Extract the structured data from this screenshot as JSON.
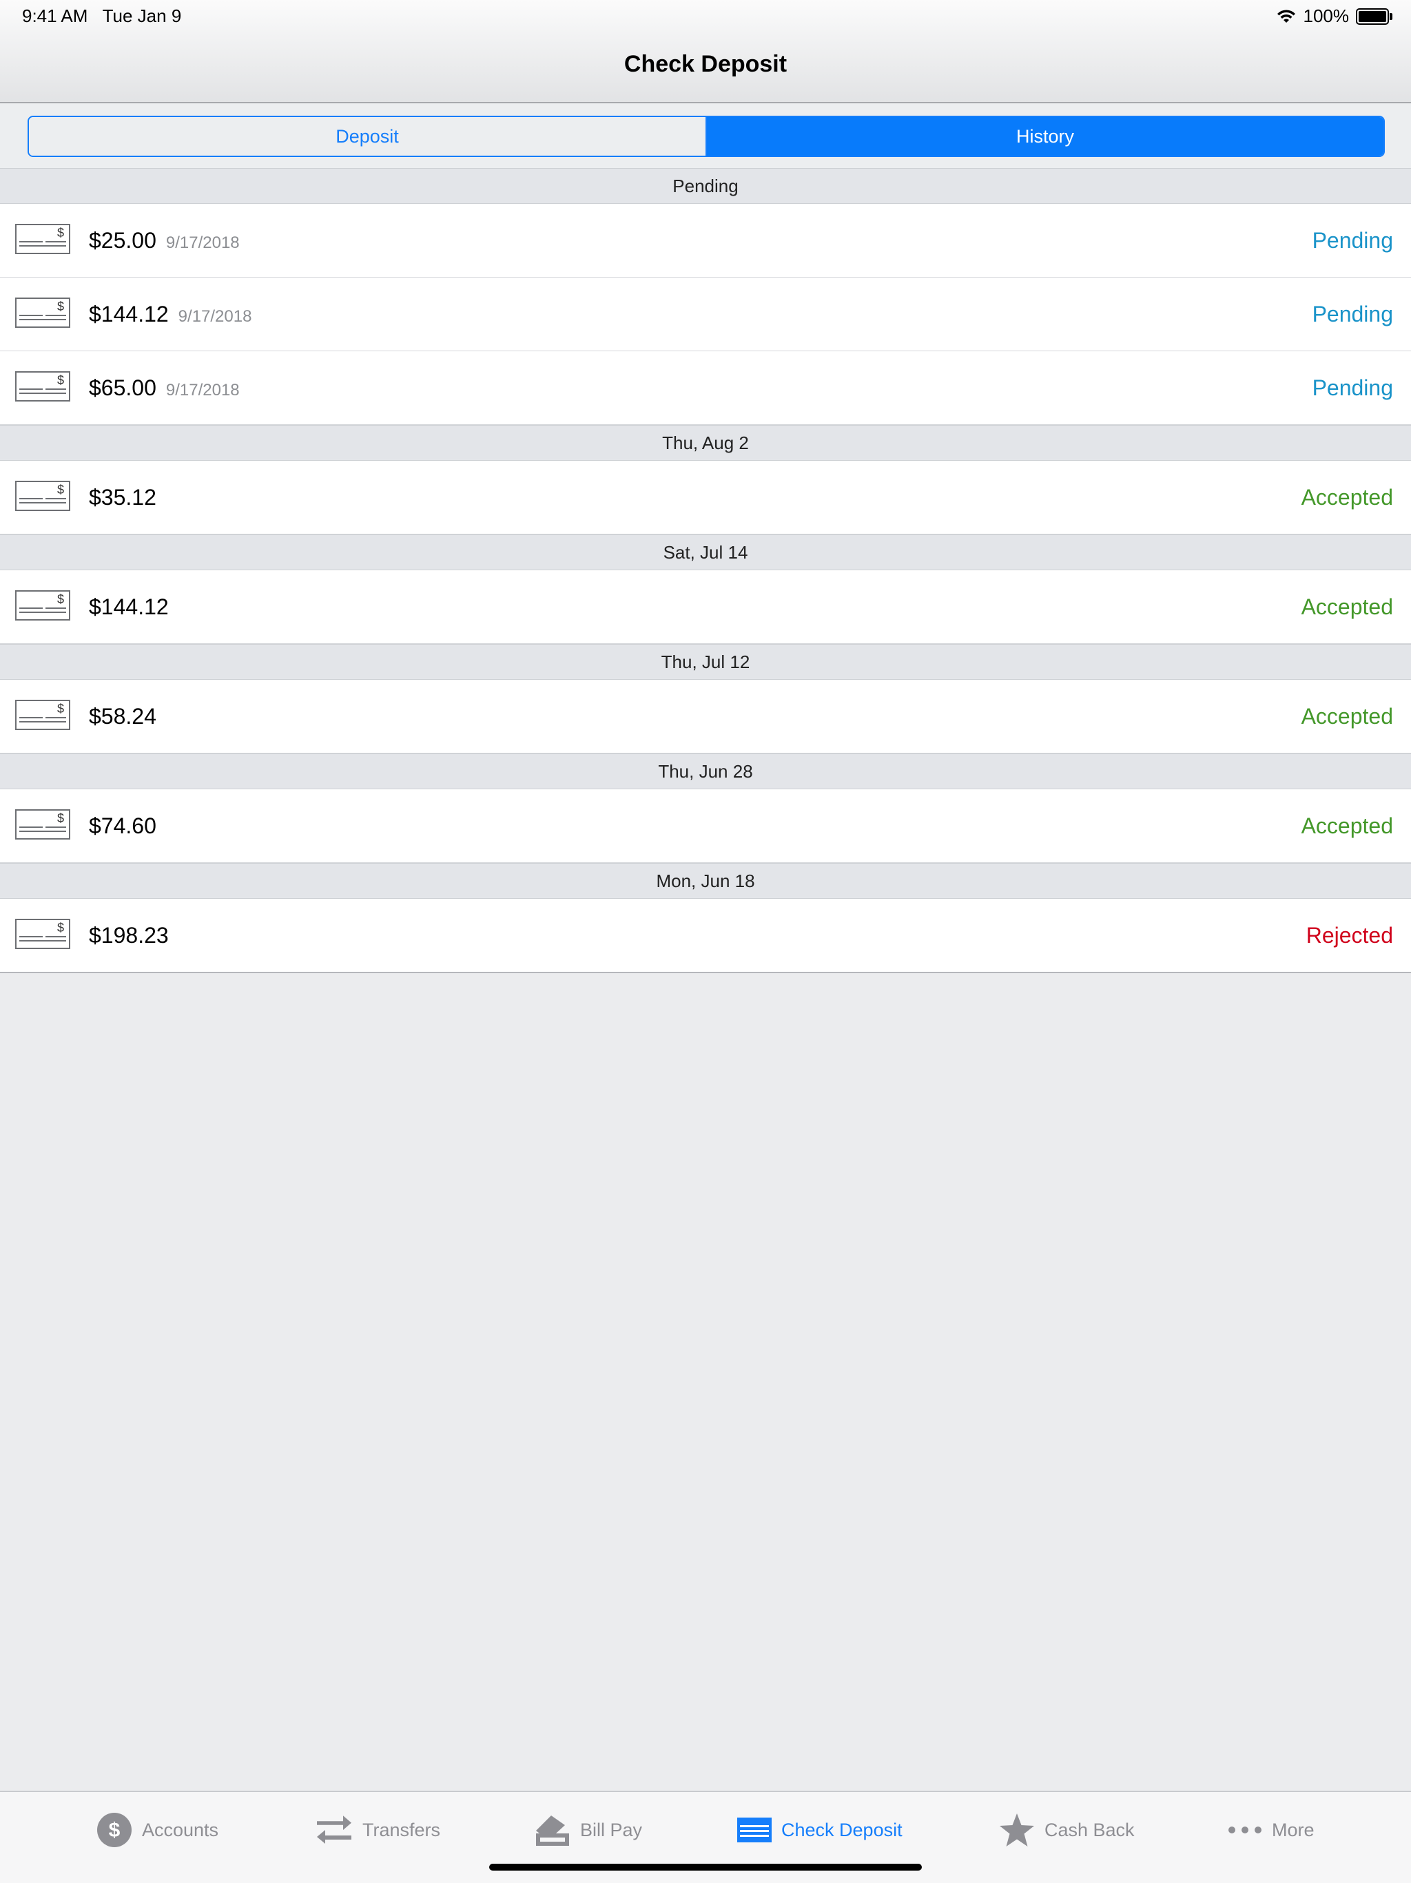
{
  "status_bar": {
    "time": "9:41 AM",
    "date": "Tue Jan 9",
    "battery": "100%"
  },
  "nav": {
    "title": "Check Deposit"
  },
  "segments": {
    "deposit": "Deposit",
    "history": "History",
    "selected": "History"
  },
  "colors": {
    "accent": "#157efb",
    "pending": "#1a93c9",
    "accepted": "#44982a",
    "rejected": "#d0021b"
  },
  "sections": [
    {
      "header": "Pending",
      "items": [
        {
          "amount": "$25.00",
          "date": "9/17/2018",
          "status": "Pending"
        },
        {
          "amount": "$144.12",
          "date": "9/17/2018",
          "status": "Pending"
        },
        {
          "amount": "$65.00",
          "date": "9/17/2018",
          "status": "Pending"
        }
      ]
    },
    {
      "header": "Thu, Aug 2",
      "items": [
        {
          "amount": "$35.12",
          "status": "Accepted"
        }
      ]
    },
    {
      "header": "Sat, Jul 14",
      "items": [
        {
          "amount": "$144.12",
          "status": "Accepted"
        }
      ]
    },
    {
      "header": "Thu, Jul 12",
      "items": [
        {
          "amount": "$58.24",
          "status": "Accepted"
        }
      ]
    },
    {
      "header": "Thu, Jun 28",
      "items": [
        {
          "amount": "$74.60",
          "status": "Accepted"
        }
      ]
    },
    {
      "header": "Mon, Jun 18",
      "items": [
        {
          "amount": "$198.23",
          "status": "Rejected"
        }
      ]
    }
  ],
  "tabbar": {
    "accounts": "Accounts",
    "transfers": "Transfers",
    "bill_pay": "Bill Pay",
    "check_deposit": "Check Deposit",
    "cash_back": "Cash Back",
    "more": "More",
    "active": "Check Deposit"
  }
}
